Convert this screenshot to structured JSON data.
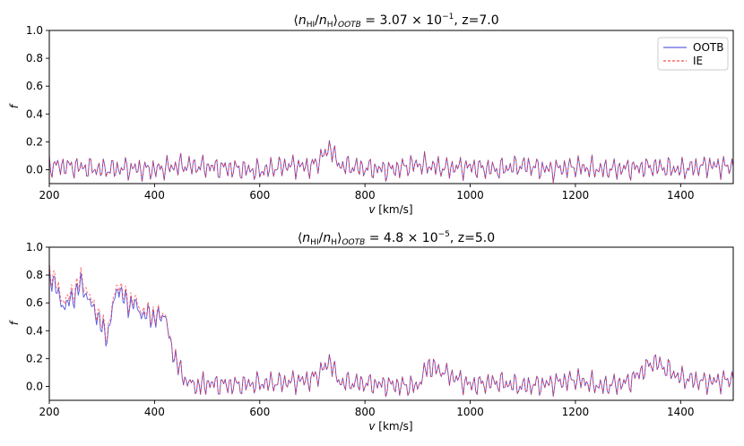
{
  "colors": {
    "ootb": "#3a3ad8",
    "ie": "#ff2020",
    "frame": "#000000"
  },
  "chart_data": [
    {
      "type": "line",
      "title_parts": {
        "open": "⟨",
        "n": "n",
        "sub_HI": "HI",
        "slash": "/",
        "sub_H": "H",
        "close": "⟩",
        "sub_OOTB": "OOTB",
        "eq": " = 3.07 × 10",
        "exp": "−1",
        "tail": ", z=7.0"
      },
      "xlabel_var": "v",
      "xlabel_unit": " [km/s]",
      "ylabel": "f",
      "xlim": [
        200,
        1500
      ],
      "ylim": [
        -0.1,
        1.0
      ],
      "xticks": [
        "200",
        "400",
        "600",
        "800",
        "1000",
        "1200",
        "1400"
      ],
      "yticks": [
        "0.0",
        "0.2",
        "0.4",
        "0.6",
        "0.8",
        "1.0"
      ],
      "legend": {
        "position": "top-right",
        "entries": [
          "OOTB",
          "IE"
        ]
      },
      "series": [
        {
          "name": "OOTB",
          "color": "#3a3ad8",
          "dash": "solid",
          "x": [
            200,
            250,
            300,
            350,
            400,
            450,
            500,
            550,
            600,
            650,
            700,
            735,
            750,
            800,
            850,
            900,
            950,
            1000,
            1050,
            1100,
            1150,
            1200,
            1250,
            1300,
            1350,
            1400,
            1450,
            1500
          ],
          "y": [
            0.03,
            0.02,
            0.0,
            0.01,
            0.0,
            0.03,
            0.02,
            0.01,
            -0.01,
            0.03,
            0.02,
            0.16,
            0.03,
            0.01,
            0.0,
            0.04,
            0.01,
            0.02,
            0.0,
            0.03,
            0.0,
            0.02,
            0.0,
            0.01,
            0.02,
            0.0,
            0.03,
            0.02
          ]
        },
        {
          "name": "IE",
          "color": "#ff2020",
          "dash": "dashed",
          "x": [
            200,
            250,
            300,
            350,
            400,
            450,
            500,
            550,
            600,
            650,
            700,
            735,
            750,
            800,
            850,
            900,
            950,
            1000,
            1050,
            1100,
            1150,
            1200,
            1250,
            1300,
            1350,
            1400,
            1450,
            1500
          ],
          "y": [
            0.03,
            0.02,
            0.0,
            0.01,
            0.0,
            0.03,
            0.02,
            0.01,
            -0.01,
            0.03,
            0.02,
            0.16,
            0.03,
            0.01,
            0.0,
            0.04,
            0.01,
            0.02,
            0.0,
            0.03,
            0.0,
            0.02,
            0.0,
            0.01,
            0.02,
            0.0,
            0.03,
            0.02
          ]
        }
      ]
    },
    {
      "type": "line",
      "title_parts": {
        "open": "⟨",
        "n": "n",
        "sub_HI": "HI",
        "slash": "/",
        "sub_H": "H",
        "close": "⟩",
        "sub_OOTB": "OOTB",
        "eq": " = 4.8 × 10",
        "exp": "−5",
        "tail": ", z=5.0"
      },
      "xlabel_var": "v",
      "xlabel_unit": " [km/s]",
      "ylabel": "f",
      "xlim": [
        200,
        1500
      ],
      "ylim": [
        -0.1,
        1.0
      ],
      "xticks": [
        "200",
        "400",
        "600",
        "800",
        "1000",
        "1200",
        "1400"
      ],
      "yticks": [
        "0.0",
        "0.2",
        "0.4",
        "0.6",
        "0.8",
        "1.0"
      ],
      "series": [
        {
          "name": "OOTB",
          "color": "#3a3ad8",
          "dash": "solid",
          "x": [
            200,
            210,
            220,
            230,
            240,
            250,
            260,
            270,
            280,
            290,
            300,
            310,
            320,
            330,
            340,
            350,
            360,
            370,
            380,
            390,
            400,
            410,
            420,
            430,
            440,
            450,
            460,
            480,
            500,
            550,
            600,
            650,
            700,
            735,
            750,
            800,
            850,
            900,
            920,
            950,
            1000,
            1050,
            1100,
            1150,
            1200,
            1250,
            1300,
            1350,
            1400,
            1450,
            1500
          ],
          "y": [
            0.8,
            0.74,
            0.62,
            0.57,
            0.62,
            0.66,
            0.74,
            0.66,
            0.58,
            0.52,
            0.42,
            0.35,
            0.55,
            0.72,
            0.64,
            0.58,
            0.6,
            0.55,
            0.5,
            0.52,
            0.48,
            0.5,
            0.52,
            0.3,
            0.2,
            0.1,
            0.04,
            0.0,
            0.02,
            0.01,
            0.02,
            0.03,
            0.05,
            0.18,
            0.03,
            0.02,
            0.01,
            0.0,
            0.15,
            0.1,
            0.01,
            0.03,
            0.0,
            0.02,
            0.05,
            0.0,
            0.03,
            0.18,
            0.06,
            0.03,
            0.05
          ]
        },
        {
          "name": "IE",
          "color": "#ff2020",
          "dash": "dashed",
          "x": [
            200,
            210,
            220,
            230,
            240,
            250,
            260,
            270,
            280,
            290,
            300,
            310,
            320,
            330,
            340,
            350,
            360,
            370,
            380,
            390,
            400,
            410,
            420,
            430,
            440,
            450,
            460,
            480,
            500,
            550,
            600,
            650,
            700,
            735,
            750,
            800,
            850,
            900,
            920,
            950,
            1000,
            1050,
            1100,
            1150,
            1200,
            1250,
            1300,
            1350,
            1400,
            1450,
            1500
          ],
          "y": [
            0.83,
            0.78,
            0.66,
            0.61,
            0.66,
            0.7,
            0.78,
            0.7,
            0.61,
            0.55,
            0.45,
            0.38,
            0.58,
            0.75,
            0.67,
            0.61,
            0.63,
            0.58,
            0.53,
            0.54,
            0.5,
            0.52,
            0.53,
            0.31,
            0.21,
            0.1,
            0.04,
            0.0,
            0.02,
            0.01,
            0.02,
            0.03,
            0.05,
            0.18,
            0.03,
            0.02,
            0.01,
            0.0,
            0.15,
            0.1,
            0.01,
            0.03,
            0.0,
            0.02,
            0.05,
            0.0,
            0.03,
            0.18,
            0.06,
            0.03,
            0.05
          ]
        }
      ]
    }
  ]
}
